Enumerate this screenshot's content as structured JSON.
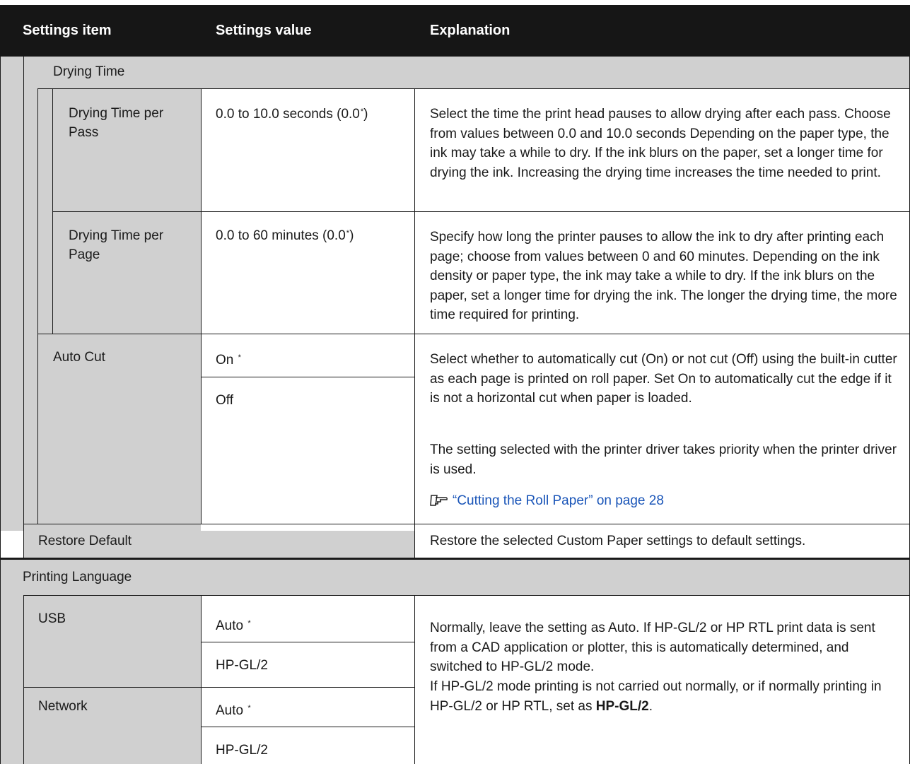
{
  "header": {
    "col1": "Settings item",
    "col2": "Settings value",
    "col3": "Explanation"
  },
  "drying_time": {
    "label": "Drying Time",
    "per_pass": {
      "label": "Drying Time per Pass",
      "value": "0.0 to 10.0 seconds (0.0",
      "value_suffix": ")",
      "default_mark": "*",
      "explanation": "Select the time the print head pauses to allow drying after each pass. Choose from values between 0.0 and 10.0 seconds Depending on the paper type, the ink may take a while to dry. If the ink blurs on the paper, set a longer time for drying the ink. Increasing the drying time increases the time needed to print."
    },
    "per_page": {
      "label": "Drying Time per Page",
      "value": "0.0 to 60 minutes (0.0",
      "value_suffix": ")",
      "default_mark": "*",
      "explanation": "Specify how long the printer pauses to allow the ink to dry after printing each page; choose from values between 0 and 60 minutes. Depending on the ink density or paper type, the ink may take a while to dry. If the ink blurs on the paper, set a longer time for drying the ink. The longer the drying time, the more time required for printing."
    }
  },
  "auto_cut": {
    "label": "Auto Cut",
    "value_on": "On",
    "value_off": "Off",
    "default_mark": "*",
    "explanation_1": "Select whether to automatically cut (On) or not cut (Off) using the built-in cutter as each page is printed on roll paper. Set On to automatically cut the edge if it is not a horizontal cut when paper is loaded.",
    "explanation_2": "The setting selected with the printer driver takes priority when the printer driver is used.",
    "link_text": "“Cutting the Roll Paper” on page 28",
    "link_icon": "reference-hand-icon"
  },
  "restore_default": {
    "label": "Restore Default",
    "explanation": "Restore the selected Custom Paper settings to default settings."
  },
  "printing_language": {
    "label": "Printing Language",
    "usb": {
      "label": "USB",
      "value_auto": "Auto",
      "value_hpgl": "HP-GL/2",
      "default_mark": "*"
    },
    "network": {
      "label": "Network",
      "value_auto": "Auto",
      "value_hpgl": "HP-GL/2",
      "default_mark": "*"
    },
    "explanation_1": "Normally, leave the setting as Auto. If HP-GL/2 or HP RTL print data is sent from a CAD application or plotter, this is automatically determined, and switched to HP-GL/2 mode.",
    "explanation_2": "If HP-GL/2 mode printing is not carried out normally, or if normally printing in HP-GL/2 or HP RTL, set as",
    "explanation_2_bold": "HP-GL/2",
    "explanation_2_end": "."
  }
}
